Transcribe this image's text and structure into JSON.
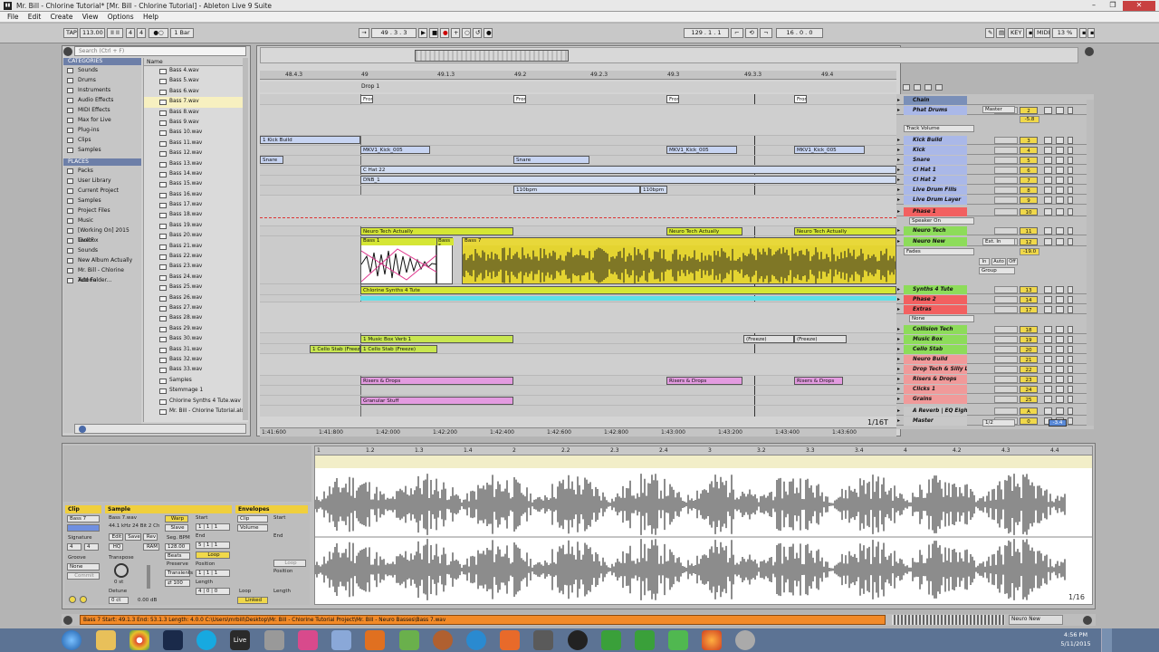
{
  "window": {
    "title": "Mr. Bill - Chlorine Tutorial*  [Mr. Bill - Chlorine Tutorial] - Ableton Live 9 Suite"
  },
  "menu": [
    "File",
    "Edit",
    "Create",
    "View",
    "Options",
    "Help"
  ],
  "control_bar": {
    "tap": "TAP",
    "tempo": "113.00",
    "sig_num": "4",
    "sig_den": "4",
    "quant": "1 Bar",
    "position": "49 . 3 . 3",
    "loop_start": "129 . 1 . 1",
    "loop_len": "16 . 0 . 0",
    "key": "KEY",
    "midi": "MIDI",
    "cpu": "13 %"
  },
  "browser": {
    "search_placeholder": "Search (Ctrl + F)",
    "categories_title": "CATEGORIES",
    "categories": [
      "Sounds",
      "Drums",
      "Instruments",
      "Audio Effects",
      "MIDI Effects",
      "Max for Live",
      "Plug-ins",
      "Clips",
      "Samples"
    ],
    "places_title": "PLACES",
    "places": [
      "Packs",
      "User Library",
      "Current Project",
      "Samples",
      "Project Files",
      "Music",
      "[Working On] 2015 Live F",
      "Toolbox",
      "Sounds",
      "New Album Actually",
      "Mr. Bill - Chlorine Tutorial",
      "Add Folder..."
    ],
    "files_header": "Name",
    "files": [
      "Bass 4.wav",
      "Bass 5.wav",
      "Bass 6.wav",
      "Bass 7.wav",
      "Bass 8.wav",
      "Bass 9.wav",
      "Bass 10.wav",
      "Bass 11.wav",
      "Bass 12.wav",
      "Bass 13.wav",
      "Bass 14.wav",
      "Bass 15.wav",
      "Bass 16.wav",
      "Bass 17.wav",
      "Bass 18.wav",
      "Bass 19.wav",
      "Bass 20.wav",
      "Bass 21.wav",
      "Bass 22.wav",
      "Bass 23.wav",
      "Bass 24.wav",
      "Bass 25.wav",
      "Bass 26.wav",
      "Bass 27.wav",
      "Bass 28.wav",
      "Bass 29.wav",
      "Bass 30.wav",
      "Bass 31.wav",
      "Bass 32.wav",
      "Bass 33.wav",
      "Samples",
      "Stemmage 1",
      "Chlorine Synths 4 Tute.wav",
      "Mr. Bill - Chlorine Tutorial.als"
    ]
  },
  "arrangement": {
    "beat_labels": [
      "48.4.3",
      "49",
      "49.1.3",
      "49.2",
      "49.2.3",
      "49.3",
      "49.3.3",
      "49.4"
    ],
    "locator": "Drop 1",
    "time_labels": [
      "1:41:600",
      "1:41:800",
      "1:42:000",
      "1:42:200",
      "1:42:400",
      "1:42:600",
      "1:42:800",
      "1:43:000",
      "1:43:200",
      "1:43:400",
      "1:43:600"
    ],
    "grid": "1/16T",
    "clips": {
      "from": "Fron",
      "kick_build": "1 Kick Build",
      "mkv1a": "MKV1_Kick_005",
      "mkv1b": "MKV1_Kick_005",
      "mkv1c": "MKV1_Kick_005",
      "snare_a": "Snare",
      "snare_b": "Snare",
      "chat": "C Hat 22",
      "dnb": "DNB_1",
      "bpm_a": "110bpm",
      "bpm_b": "110bpm",
      "neuro_a": "Neuro Tech Actually",
      "neuro_b": "Neuro Tech Actually",
      "neuro_c": "Neuro Tech Actually",
      "bass1": "Bass 1",
      "bass5": "Bass 5",
      "bass7": "Bass 7",
      "synths": "Chlorine Synths 4 Tute",
      "musicbox": "1 Music Box Verb 1",
      "cello_a": "1 Cello Stab (Freeze)",
      "cello_b": "1 Cello Stab (Freeze)",
      "freeze_a": "(Freeze)",
      "freeze_b": "(Freeze)",
      "risers_a": "Risers & Drops",
      "risers_b": "Risers & Drops",
      "risers_c": "Risers & Drops",
      "granular": "Granular Stuff"
    }
  },
  "mixer": {
    "tracks": [
      {
        "name": "Chain",
        "num": "",
        "color": "#7a8fb8"
      },
      {
        "name": "Phat Drums",
        "num": "2",
        "color": "#aab8e8"
      },
      {
        "name": "Kick Build",
        "num": "3",
        "color": "#aab8e8"
      },
      {
        "name": "Kick",
        "num": "4",
        "color": "#aab8e8"
      },
      {
        "name": "Snare",
        "num": "5",
        "color": "#aab8e8"
      },
      {
        "name": "Cl Hat 1",
        "num": "6",
        "color": "#aab8e8"
      },
      {
        "name": "Cl Hat 2",
        "num": "7",
        "color": "#aab8e8"
      },
      {
        "name": "Live Drum Fills",
        "num": "8",
        "color": "#aab8e8"
      },
      {
        "name": "Live Drum Layer",
        "num": "9",
        "color": "#aab8e8"
      },
      {
        "name": "Phase 1",
        "num": "10",
        "color": "#f26060"
      },
      {
        "name": "Neuro Tech",
        "num": "11",
        "color": "#8ddc5a"
      },
      {
        "name": "Neuro New",
        "num": "12",
        "color": "#8ddc5a"
      },
      {
        "name": "Synths 4 Tute",
        "num": "13",
        "color": "#8ddc5a"
      },
      {
        "name": "Phase 2",
        "num": "14",
        "color": "#f26060"
      },
      {
        "name": "Extras",
        "num": "17",
        "color": "#f26060"
      },
      {
        "name": "Collision Tech",
        "num": "18",
        "color": "#8ddc5a"
      },
      {
        "name": "Music Box",
        "num": "19",
        "color": "#8ddc5a"
      },
      {
        "name": "Cello Stab",
        "num": "20",
        "color": "#8ddc5a"
      },
      {
        "name": "Neuro Build",
        "num": "21",
        "color": "#f09a9a"
      },
      {
        "name": "Drop Tech & Silly Lead",
        "num": "22",
        "color": "#f09a9a"
      },
      {
        "name": "Risers & Drops",
        "num": "23",
        "color": "#f09a9a"
      },
      {
        "name": "Clicks 1",
        "num": "24",
        "color": "#f09a9a"
      },
      {
        "name": "Grains",
        "num": "25",
        "color": "#f09a9a"
      },
      {
        "name": "A Reverb | EQ Eight",
        "num": "A",
        "color": "#c8c8c8"
      },
      {
        "name": "Master",
        "num": "0",
        "color": "#c8c8c8"
      }
    ],
    "io": {
      "master": "Master",
      "track_volume": "Track Volume",
      "speaker_on": "Speaker On",
      "ext_in": "Ext. In",
      "fades": "Fades",
      "in": "In",
      "auto": "Auto",
      "off": "Off",
      "group": "Group",
      "none": "None",
      "vol1": "-5.8",
      "vol2": "-19.0",
      "master_vol": "-3.4",
      "half": "1/2"
    }
  },
  "detail": {
    "clip_title": "Clip",
    "clip_name": "Bass 7",
    "sample_title": "Sample",
    "sample_file": "Bass 7.wav",
    "sample_info": "44.1 kHz 24 Bit 2 Ch",
    "warp": "Warp",
    "save": "Save",
    "edit": "Edit",
    "rev": "Rev",
    "hq": "HQ",
    "ram": "RAM",
    "seg_bpm_label": "Seg. BPM",
    "seg_bpm": "128.00",
    "beats": "Beats",
    "preserve": "Preserve",
    "transients": "Transients",
    "signature": "Signature",
    "groove": "Groove",
    "none": "None",
    "commit": "Commit",
    "transpose": "Transpose",
    "transpose_val": "0 st",
    "detune": "Detune",
    "detune_val": "0 ct",
    "gain": "0.00 dB",
    "start": "Start",
    "end": "End",
    "loop": "Loop",
    "position": "Position",
    "length": "Length",
    "linked": "Linked",
    "env_title": "Envelopes",
    "env_clip": "Clip",
    "env_volume": "Volume",
    "ruler": [
      "1",
      "1.2",
      "1.3",
      "1.4",
      "2",
      "2.2",
      "2.3",
      "2.4",
      "3",
      "3.2",
      "3.3",
      "3.4",
      "4",
      "4.2",
      "4.3",
      "4.4"
    ],
    "grid": "1/16"
  },
  "status": {
    "message": "Bass 7  Start: 49.1.3  End: 53.1.3  Length: 4.0.0  C:\\Users\\mrbill\\Desktop\\Mr. Bill - Chlorine Tutorial Project\\Mr. Bill - Neuro Basses\\Bass 7.wav",
    "track": "Neuro New"
  },
  "taskbar": {
    "time": "4:56 PM",
    "date": "5/11/2015",
    "live": "Live"
  }
}
